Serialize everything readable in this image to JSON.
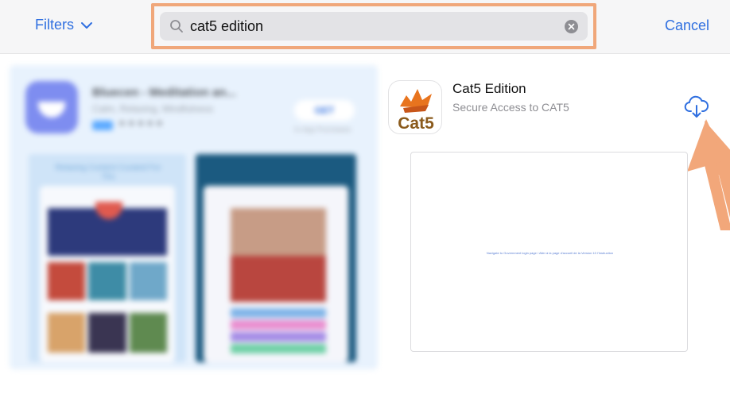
{
  "header": {
    "filters_label": "Filters",
    "search_query": "cat5 edition",
    "cancel_label": "Cancel"
  },
  "promo": {
    "app_title": "Bluecen - Meditation an...",
    "app_subtitle": "Calm, Relaxing, Mindfulness",
    "stars": "★★★★★",
    "get_label": "GET",
    "inapp_note": "In-App Purchases",
    "screenshot_caption": "Relaxing Content Curated For You"
  },
  "result": {
    "title": "Cat5 Edition",
    "subtitle": "Secure Access to CAT5",
    "icon_text": "Cat5",
    "preview_text": "Navigate to Government login page / Aller à la page d'accueil de la Version 10 l'Instruction"
  },
  "colors": {
    "accent": "#2f6fe0",
    "highlight": "#f0a77a",
    "cat5_brown": "#8a5a1c",
    "cat5_orange": "#e8741e"
  },
  "icons": [
    "chevron-down-icon",
    "search-icon",
    "clear-icon",
    "cloud-download-icon"
  ]
}
